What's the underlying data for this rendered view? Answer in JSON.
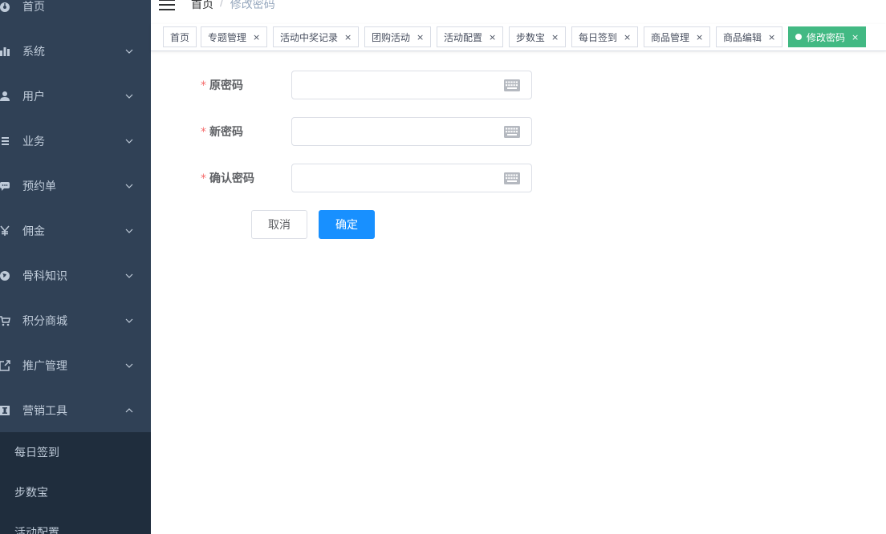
{
  "sidebar": {
    "items": [
      {
        "label": "首页",
        "icon": "dashboard-icon"
      },
      {
        "label": "系统",
        "icon": "chart-bar-icon"
      },
      {
        "label": "用户",
        "icon": "user-icon"
      },
      {
        "label": "业务",
        "icon": "list-icon"
      },
      {
        "label": "预约单",
        "icon": "comment-icon"
      },
      {
        "label": "佣金",
        "icon": "yen-icon"
      },
      {
        "label": "骨科知识",
        "icon": "globe-icon"
      },
      {
        "label": "积分商城",
        "icon": "cart-icon"
      },
      {
        "label": "推广管理",
        "icon": "share-icon"
      },
      {
        "label": "营销工具",
        "icon": "tool-icon"
      }
    ],
    "submenu": [
      "每日签到",
      "步数宝",
      "活动配置"
    ]
  },
  "header": {
    "breadcrumb": [
      "首页",
      "修改密码"
    ],
    "separator": "/"
  },
  "tags": [
    {
      "label": "首页",
      "closable": false,
      "active": false
    },
    {
      "label": "专题管理",
      "closable": true,
      "active": false
    },
    {
      "label": "活动中奖记录",
      "closable": true,
      "active": false
    },
    {
      "label": "团购活动",
      "closable": true,
      "active": false
    },
    {
      "label": "活动配置",
      "closable": true,
      "active": false
    },
    {
      "label": "步数宝",
      "closable": true,
      "active": false
    },
    {
      "label": "每日签到",
      "closable": true,
      "active": false
    },
    {
      "label": "商品管理",
      "closable": true,
      "active": false
    },
    {
      "label": "商品编辑",
      "closable": true,
      "active": false
    },
    {
      "label": "修改密码",
      "closable": true,
      "active": true
    }
  ],
  "tag_close": "×",
  "form": {
    "required_mark": "*",
    "fields": [
      {
        "label": "原密码",
        "value": ""
      },
      {
        "label": "新密码",
        "value": ""
      },
      {
        "label": "确认密码",
        "value": ""
      }
    ],
    "cancel_label": "取消",
    "confirm_label": "确定"
  },
  "colors": {
    "sidebar_bg": "#304156",
    "submenu_bg": "#1f2d3d",
    "sidebar_text": "#bfcbd9",
    "active_tag": "#42b983",
    "primary": "#1890ff",
    "required": "#f56c6c"
  }
}
